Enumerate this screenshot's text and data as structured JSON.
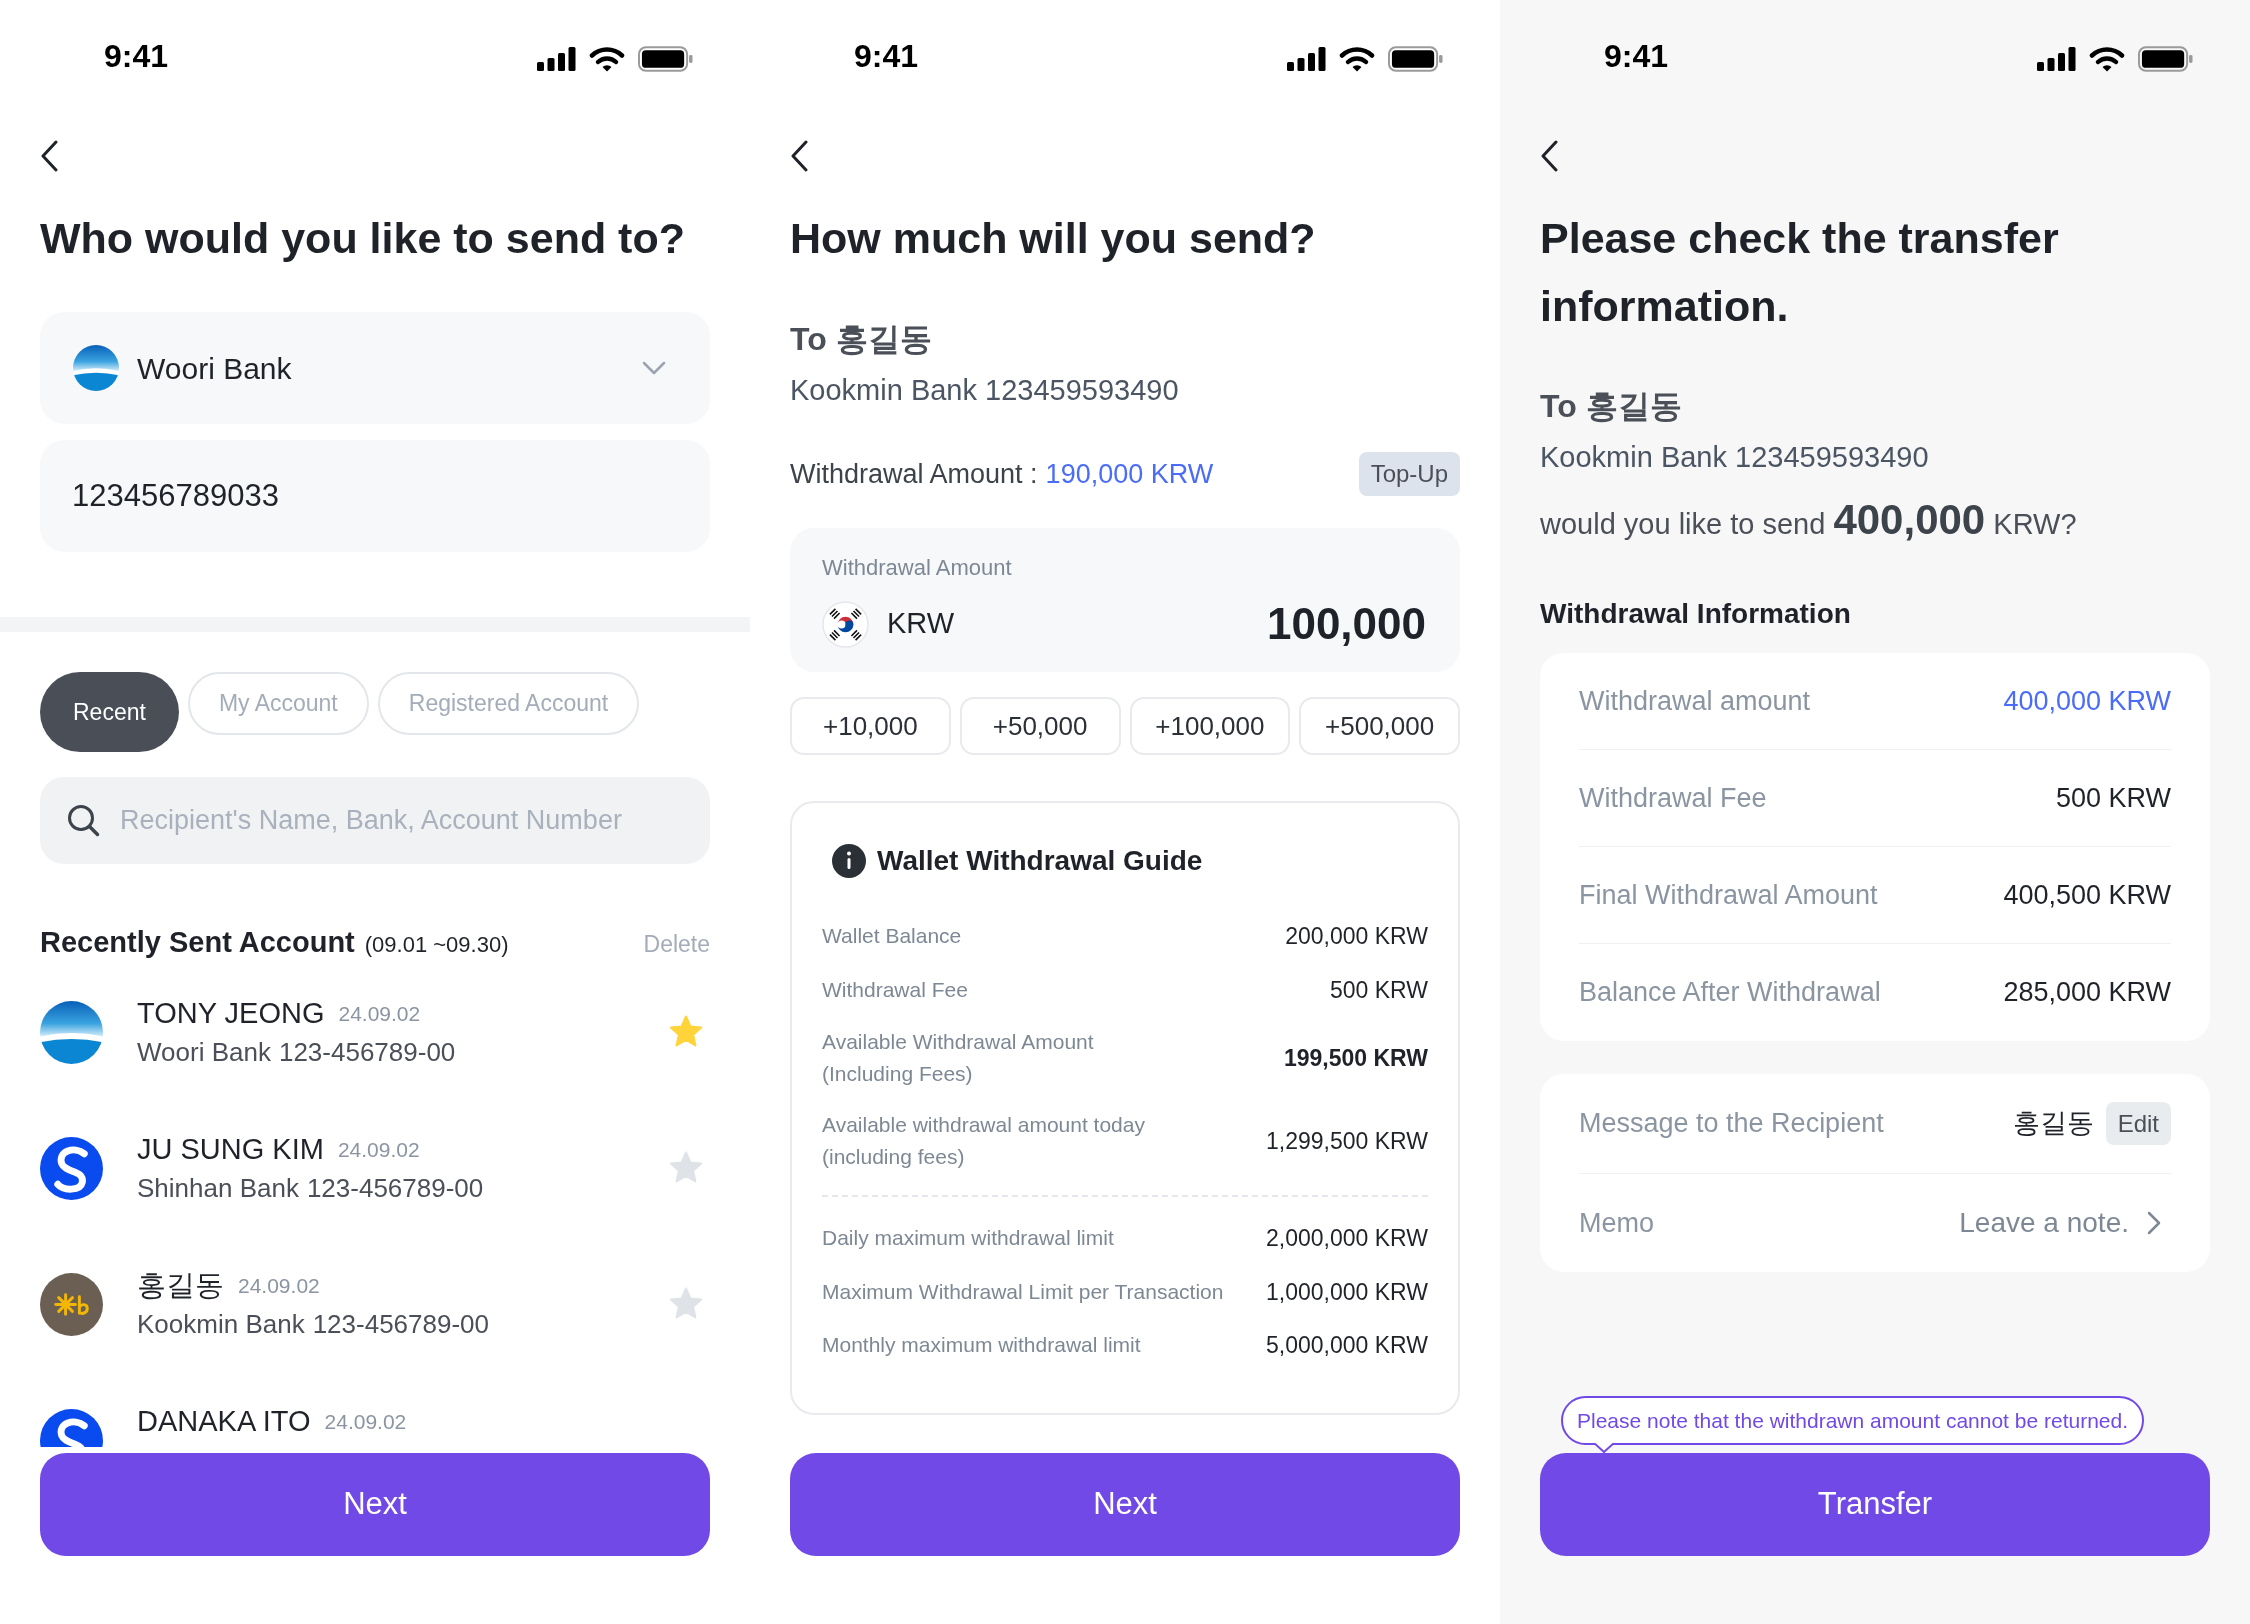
{
  "send_to_screen": {
    "status_bar": {
      "time": "9:41"
    },
    "title": "Who would you like to send to?",
    "bank_select": {
      "value": "Woori Bank",
      "kind": "woori"
    },
    "account_field": {
      "value": "123456789033"
    },
    "tabs": [
      {
        "label": "Recent",
        "selected": true
      },
      {
        "label": "My Account",
        "selected": false
      },
      {
        "label": "Registered Account",
        "selected": false
      }
    ],
    "search": {
      "placeholder": "Recipient's Name, Bank, Account Number"
    },
    "recent_accounts": {
      "title": "Recently Sent Account",
      "period": "(09.01 ~09.30)",
      "delete": "Delete",
      "items": [
        {
          "kind": "woori",
          "name": "TONY JEONG",
          "date": "24.09.02",
          "bank": "Woori Bank",
          "account": "123-456789-00",
          "favorite": true
        },
        {
          "kind": "shinhan",
          "name": "JU SUNG KIM",
          "date": "24.09.02",
          "bank": "Shinhan Bank",
          "account": "123-456789-00",
          "favorite": false
        },
        {
          "kind": "kookmin",
          "name": "홍길동",
          "date": "24.09.02",
          "bank": "Kookmin Bank",
          "account": "123-456789-00",
          "favorite": false
        },
        {
          "kind": "shinhan",
          "name": "DANAKA ITO",
          "date": "24.09.02"
        }
      ]
    },
    "button": "Next"
  },
  "amount_screen": {
    "status_bar": {
      "time": "9:41"
    },
    "title": "How much will you send?",
    "recipient": {
      "name": "To 홍길동",
      "account": "Kookmin Bank 123459593490"
    },
    "balance": {
      "label": "Withdrawal Amount :",
      "value": "190,000 KRW",
      "top_up": "Top-Up"
    },
    "amount_field": {
      "label": "Withdrawal Amount",
      "currency": "KRW",
      "value": "100,000"
    },
    "quick_amounts": [
      "+10,000",
      "+50,000",
      "+100,000",
      "+500,000"
    ],
    "guide": {
      "title": "Wallet Withdrawal Guide",
      "balances": [
        {
          "label": "Wallet Balance",
          "value": "200,000 KRW",
          "emphasis": false
        },
        {
          "label": "Withdrawal Fee",
          "value": "500 KRW",
          "emphasis": false
        },
        {
          "label": "Available Withdrawal Amount (Including Fees)",
          "value": "199,500 KRW",
          "emphasis": true
        },
        {
          "label": "Available withdrawal amount today (including fees)",
          "value": "1,299,500 KRW",
          "emphasis": false
        }
      ],
      "limits": [
        {
          "label": "Daily maximum withdrawal limit",
          "value": "2,000,000 KRW",
          "emphasis": false
        },
        {
          "label": "Maximum Withdrawal Limit per Transaction",
          "value": "1,000,000 KRW",
          "emphasis": false
        },
        {
          "label": "Monthly maximum withdrawal limit",
          "value": "5,000,000 KRW",
          "emphasis": false
        }
      ]
    },
    "button": "Next"
  },
  "confirm_screen": {
    "status_bar": {
      "time": "9:41"
    },
    "title": "Please check the transfer information.",
    "recipient": {
      "name": "To 홍길동",
      "account": "Kookmin Bank 123459593490"
    },
    "question": "would you like to send **400,000** KRW?",
    "withdrawal_info": {
      "title": "Withdrawal Information",
      "rows": [
        {
          "label": "Withdrawal amount",
          "value": "400,000 KRW",
          "highlight": true
        },
        {
          "label": "Withdrawal Fee",
          "value": "500 KRW",
          "highlight": false
        },
        {
          "label": "Final Withdrawal Amount",
          "value": "400,500 KRW",
          "highlight": false
        },
        {
          "label": "Balance After Withdrawal",
          "value": "285,000 KRW",
          "highlight": false
        }
      ]
    },
    "message": {
      "label": "Message to the Recipient",
      "value": "홍길동",
      "edit": "Edit"
    },
    "memo": {
      "label": "Memo",
      "value": "Leave a note."
    },
    "notice": "Please note that the withdrawn amount cannot be returned.",
    "button": "Transfer"
  }
}
